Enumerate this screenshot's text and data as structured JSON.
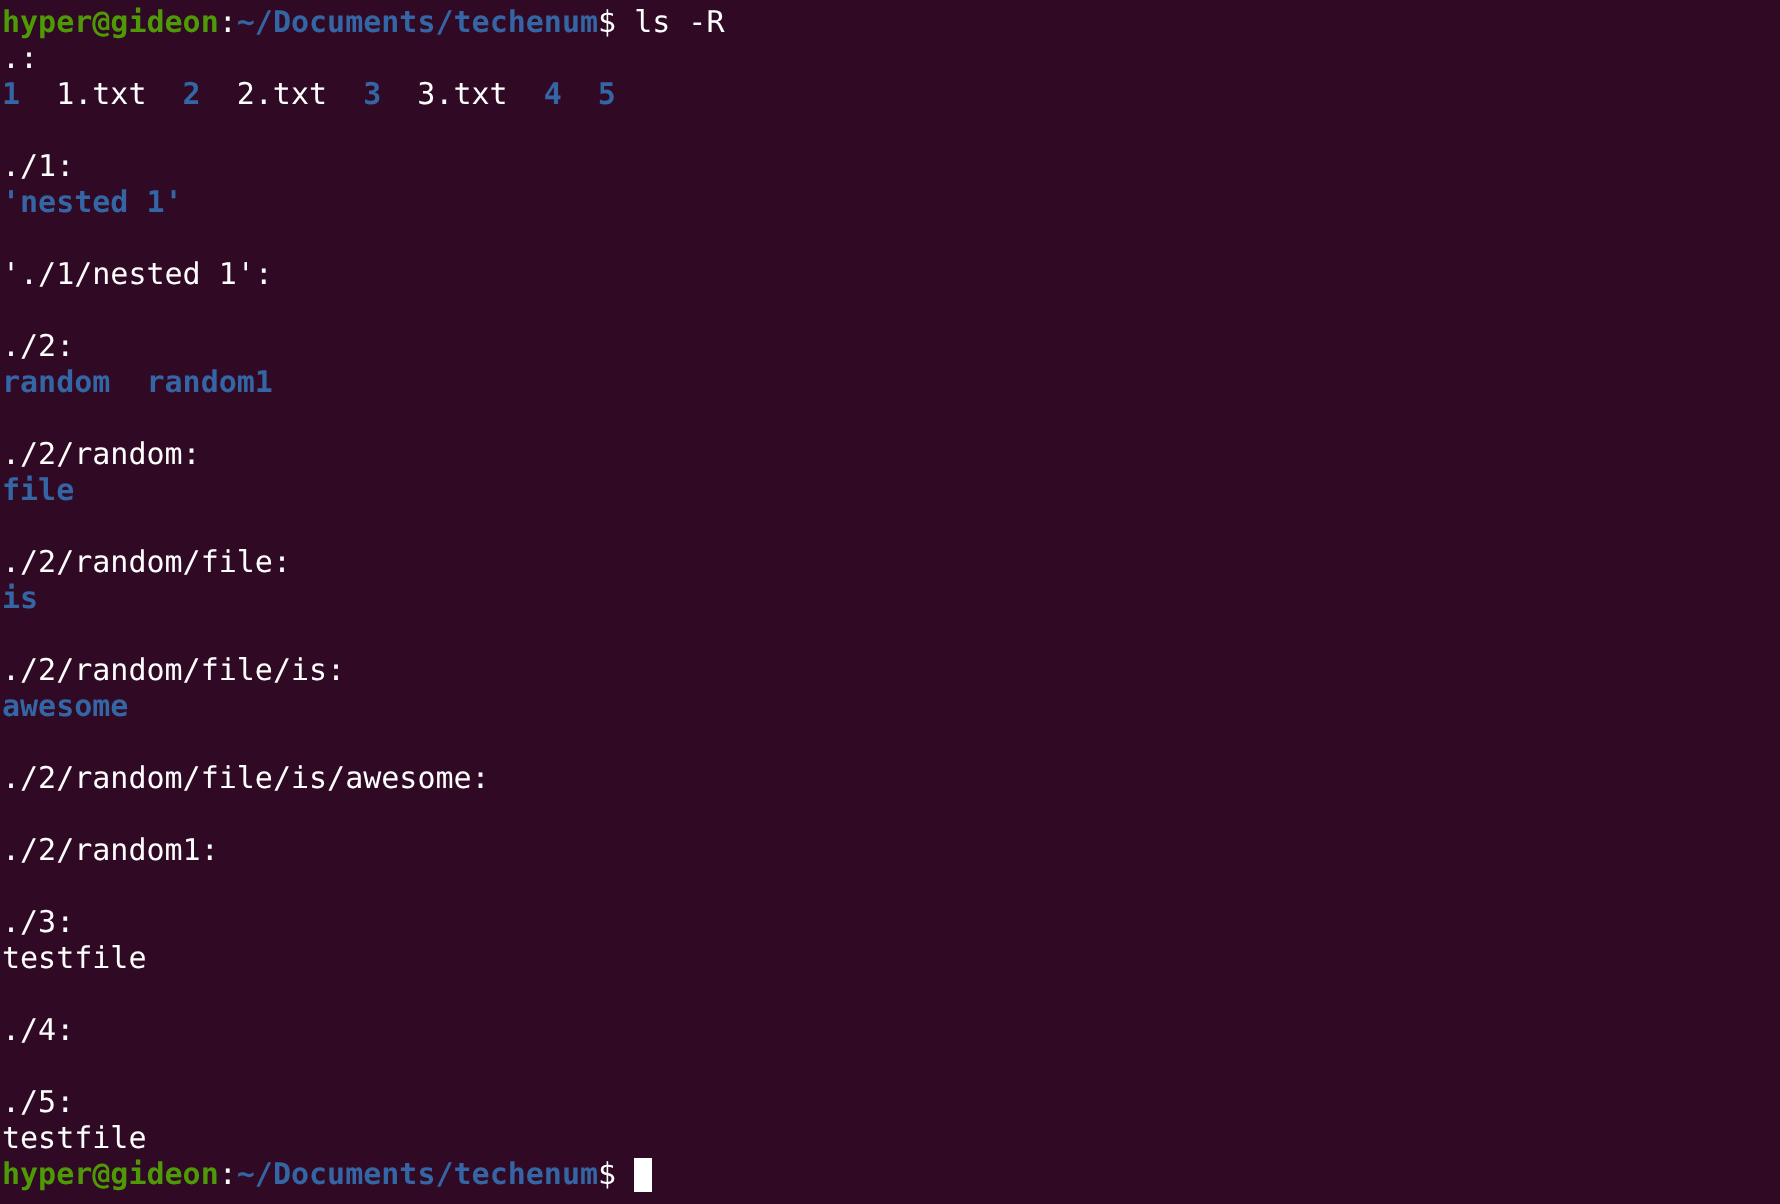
{
  "terminal": {
    "lines": [
      {
        "kind": "prompt",
        "user": "hyper@gideon",
        "separator": ":",
        "path": "~/Documents/techenum",
        "symbol": "$",
        "command": "ls -R",
        "cursor": false
      },
      {
        "kind": "text",
        "text": ".:"
      },
      {
        "kind": "listing",
        "entries": [
          {
            "name": "1",
            "kind": "dir"
          },
          {
            "name": "1.txt",
            "kind": "file"
          },
          {
            "name": "2",
            "kind": "dir"
          },
          {
            "name": "2.txt",
            "kind": "file"
          },
          {
            "name": "3",
            "kind": "dir"
          },
          {
            "name": "3.txt",
            "kind": "file"
          },
          {
            "name": "4",
            "kind": "dir"
          },
          {
            "name": "5",
            "kind": "dir"
          }
        ]
      },
      {
        "kind": "blank"
      },
      {
        "kind": "text",
        "text": "./1:"
      },
      {
        "kind": "listing",
        "entries": [
          {
            "name": "'nested 1'",
            "kind": "dir"
          }
        ]
      },
      {
        "kind": "blank"
      },
      {
        "kind": "text",
        "text": "'./1/nested 1':"
      },
      {
        "kind": "blank"
      },
      {
        "kind": "text",
        "text": "./2:"
      },
      {
        "kind": "listing",
        "entries": [
          {
            "name": "random",
            "kind": "dir"
          },
          {
            "name": "random1",
            "kind": "dir"
          }
        ]
      },
      {
        "kind": "blank"
      },
      {
        "kind": "text",
        "text": "./2/random:"
      },
      {
        "kind": "listing",
        "entries": [
          {
            "name": "file",
            "kind": "dir"
          }
        ]
      },
      {
        "kind": "blank"
      },
      {
        "kind": "text",
        "text": "./2/random/file:"
      },
      {
        "kind": "listing",
        "entries": [
          {
            "name": "is",
            "kind": "dir"
          }
        ]
      },
      {
        "kind": "blank"
      },
      {
        "kind": "text",
        "text": "./2/random/file/is:"
      },
      {
        "kind": "listing",
        "entries": [
          {
            "name": "awesome",
            "kind": "dir"
          }
        ]
      },
      {
        "kind": "blank"
      },
      {
        "kind": "text",
        "text": "./2/random/file/is/awesome:"
      },
      {
        "kind": "blank"
      },
      {
        "kind": "text",
        "text": "./2/random1:"
      },
      {
        "kind": "blank"
      },
      {
        "kind": "text",
        "text": "./3:"
      },
      {
        "kind": "listing",
        "entries": [
          {
            "name": "testfile",
            "kind": "file"
          }
        ]
      },
      {
        "kind": "blank"
      },
      {
        "kind": "text",
        "text": "./4:"
      },
      {
        "kind": "blank"
      },
      {
        "kind": "text",
        "text": "./5:"
      },
      {
        "kind": "listing",
        "entries": [
          {
            "name": "testfile",
            "kind": "file"
          }
        ]
      },
      {
        "kind": "prompt",
        "user": "hyper@gideon",
        "separator": ":",
        "path": "~/Documents/techenum",
        "symbol": "$",
        "cursor": true
      }
    ]
  }
}
